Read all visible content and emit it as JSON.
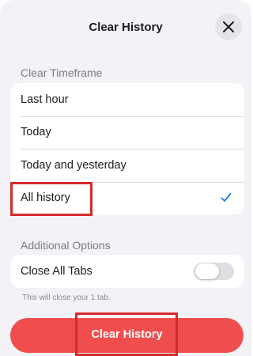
{
  "header": {
    "title": "Clear History"
  },
  "icons": {
    "close": "close-icon",
    "check": "checkmark-icon"
  },
  "colors": {
    "accent": "#1a7cf0",
    "destructive": "#f04e4e",
    "annotation": "#d62a2a"
  },
  "timeframe": {
    "section_title": "Clear Timeframe",
    "options": [
      {
        "label": "Last hour",
        "selected": false
      },
      {
        "label": "Today",
        "selected": false
      },
      {
        "label": "Today and yesterday",
        "selected": false
      },
      {
        "label": "All history",
        "selected": true
      }
    ]
  },
  "additional": {
    "section_title": "Additional Options",
    "close_all_tabs": {
      "label": "Close All Tabs",
      "enabled": false
    },
    "footnote": "This will close your 1 tab."
  },
  "action": {
    "clear_label": "Clear History"
  }
}
